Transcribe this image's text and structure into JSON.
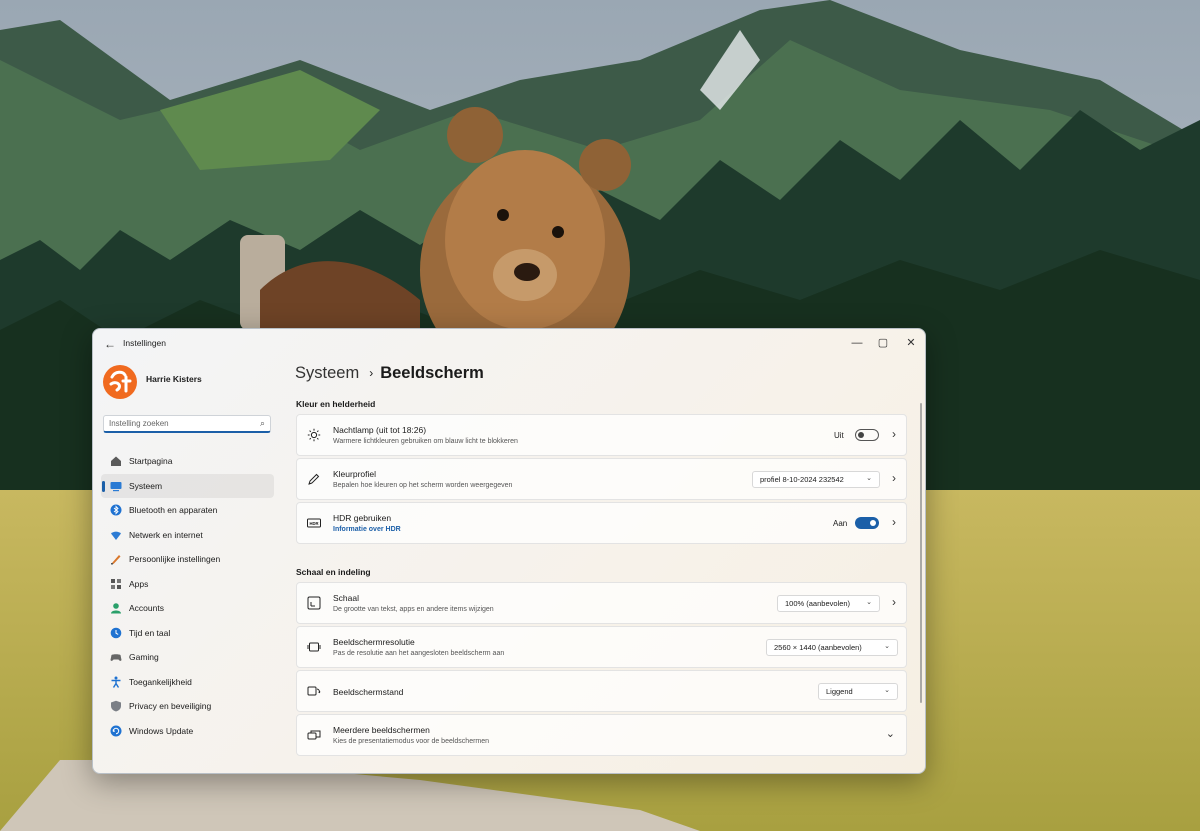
{
  "window": {
    "app_title": "Instellingen"
  },
  "profile": {
    "name": "Harrie Kisters"
  },
  "search": {
    "placeholder": "Instelling zoeken"
  },
  "sidebar": {
    "items": [
      {
        "label": "Startpagina",
        "icon": "home-icon",
        "active": false
      },
      {
        "label": "Systeem",
        "icon": "system-icon",
        "active": true
      },
      {
        "label": "Bluetooth en apparaten",
        "icon": "bluetooth-icon",
        "active": false
      },
      {
        "label": "Netwerk en internet",
        "icon": "network-icon",
        "active": false
      },
      {
        "label": "Persoonlijke instellingen",
        "icon": "personalization-icon",
        "active": false
      },
      {
        "label": "Apps",
        "icon": "apps-icon",
        "active": false
      },
      {
        "label": "Accounts",
        "icon": "accounts-icon",
        "active": false
      },
      {
        "label": "Tijd en taal",
        "icon": "time-language-icon",
        "active": false
      },
      {
        "label": "Gaming",
        "icon": "gaming-icon",
        "active": false
      },
      {
        "label": "Toegankelijkheid",
        "icon": "accessibility-icon",
        "active": false
      },
      {
        "label": "Privacy en beveiliging",
        "icon": "privacy-shield-icon",
        "active": false
      },
      {
        "label": "Windows Update",
        "icon": "windows-update-icon",
        "active": false
      }
    ]
  },
  "breadcrumb": {
    "parent": "Systeem",
    "separator": "›",
    "current": "Beeldscherm"
  },
  "sections": {
    "color": "Kleur en helderheid",
    "scale": "Schaal en indeling"
  },
  "cards": {
    "nightlight": {
      "title": "Nachtlamp (uit tot 18:26)",
      "subtitle": "Warmere lichtkleuren gebruiken om blauw licht te blokkeren",
      "state_label": "Uit",
      "state": false
    },
    "colorprofile": {
      "title": "Kleurprofiel",
      "subtitle": "Bepalen hoe kleuren op het scherm worden weergegeven",
      "value": "profiel 8-10-2024 232542"
    },
    "hdr": {
      "title": "HDR gebruiken",
      "link": "Informatie over HDR",
      "state_label": "Aan",
      "state": true
    },
    "scale": {
      "title": "Schaal",
      "subtitle": "De grootte van tekst, apps en andere items wijzigen",
      "value": "100% (aanbevolen)"
    },
    "resolution": {
      "title": "Beeldschermresolutie",
      "subtitle": "Pas de resolutie aan het aangesloten beeldscherm aan",
      "value": "2560 × 1440 (aanbevolen)"
    },
    "orientation": {
      "title": "Beeldschermstand",
      "value": "Liggend"
    },
    "multiple": {
      "title": "Meerdere beeldschermen",
      "subtitle": "Kies de presentatiemodus voor de beeldschermen"
    }
  },
  "colors": {
    "accent": "#1b5fa8",
    "avatar": "#f06a1f"
  }
}
